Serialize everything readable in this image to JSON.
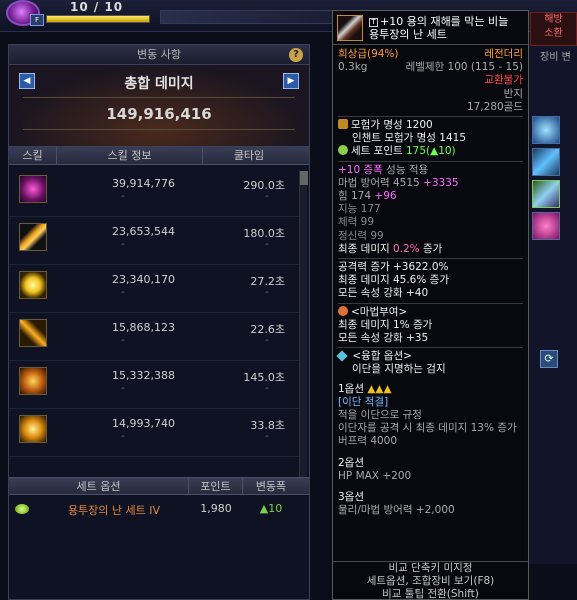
{
  "player": {
    "hp_text": "10 / 10",
    "hp_fraction": 1.0,
    "level_badge": "F"
  },
  "damage_window": {
    "title": "변동 사항",
    "help_icon": "?",
    "panel_title": "총합 데미지",
    "total_damage": "149,916,416",
    "prev_label": "◀",
    "next_label": "▶",
    "columns": [
      "스킬",
      "스킬 정보",
      "쿨타임"
    ],
    "skills": [
      {
        "damage": "39,914,776",
        "cooldown": "290.0초",
        "icon": "purple-burst-skill-icon"
      },
      {
        "damage": "23,653,544",
        "cooldown": "180.0초",
        "icon": "crossed-blades-skill-icon"
      },
      {
        "damage": "23,340,170",
        "cooldown": "27.2초",
        "icon": "golden-orb-skill-icon"
      },
      {
        "damage": "15,868,123",
        "cooldown": "22.6초",
        "icon": "yellow-slash-skill-icon"
      },
      {
        "damage": "15,332,388",
        "cooldown": "145.0초",
        "icon": "fire-fist-skill-icon"
      },
      {
        "damage": "14,993,740",
        "cooldown": "33.8초",
        "icon": "solar-flare-skill-icon"
      }
    ],
    "dash": "-",
    "set_columns": [
      "세트 옵션",
      "포인트",
      "변동폭"
    ],
    "set_row": {
      "name": "용투장의 난 세트 IV",
      "points": "1,980",
      "delta": "▲10"
    }
  },
  "right_panel": {
    "tab_line1": "해방",
    "tab_line2": "소환",
    "equip_tab": "장비 변",
    "refresh_icon": "⟳"
  },
  "tooltip": {
    "lock_icon": "T",
    "name_line1": "+10 용의 재해를 막는 비늘",
    "name_line2": "용투장의 난 세트",
    "grade_label": "희상급(94%)",
    "rarity": "레전더리",
    "weight": "0.3kg",
    "level_limit": "레벨제한 100 (115 - 15)",
    "trade": "교환불가",
    "slot": "반지",
    "price": "17,280골드",
    "adventurer_fame": "모험가 명성 1200",
    "enchant_fame": "인챈트 모험가 명성 1415",
    "set_point_label": "세트 포인트",
    "set_point_value": "175(▲10)",
    "reinforce_label": "+10 증폭",
    "reinforce_suffix": "성능 적용",
    "magic_def_label": "마법 방어력 4515",
    "magic_def_bonus": "+3335",
    "str_label": "힘 174",
    "str_bonus": "+96",
    "int_label": "지능 177",
    "vit_label": "체력 99",
    "spi_label": "정신력 99",
    "final_dmg_pre": "최종 데미지",
    "final_dmg_val": "0.2%",
    "final_dmg_post": "증가",
    "atk_inc": "공격력 증가 +3622.0%",
    "final_dmg2": "최종 데미지 45.6% 증가",
    "all_elem": "모든 속성 강화 +40",
    "ench_title": "<마법부여>",
    "ench_dmg": "최종 데미지 1% 증가",
    "ench_elem": "모든 속성 강화 +35",
    "fuse_title": "<융합 옵션>",
    "fuse_sub": "이단을 지명하는 검지",
    "opt1_label": "1옵션",
    "opt1_stars": "▲▲▲",
    "opt1_tag": "[이단 척결]",
    "opt1_desc1": "적을 이단으로 규정",
    "opt1_desc2": "이단자를 공격 시 최종 데미지 13% 증가",
    "opt1_desc3": "버프력 4000",
    "opt2_label": "2옵션",
    "opt2_desc": "HP MAX +200",
    "opt3_label": "3옵션",
    "opt3_desc": "물리/마법 방어력 +2,000",
    "foot1": "비교 단축키 미지정",
    "foot2": "세트옵션, 조합장비 보기(F8)",
    "foot3": "비교 툴팁 전환(Shift)"
  },
  "colors": {
    "legendary": "#ff9f3a",
    "set_name": "#e0883a",
    "increase": "#7ad04a",
    "magenta_stat": "#ff6aff"
  }
}
